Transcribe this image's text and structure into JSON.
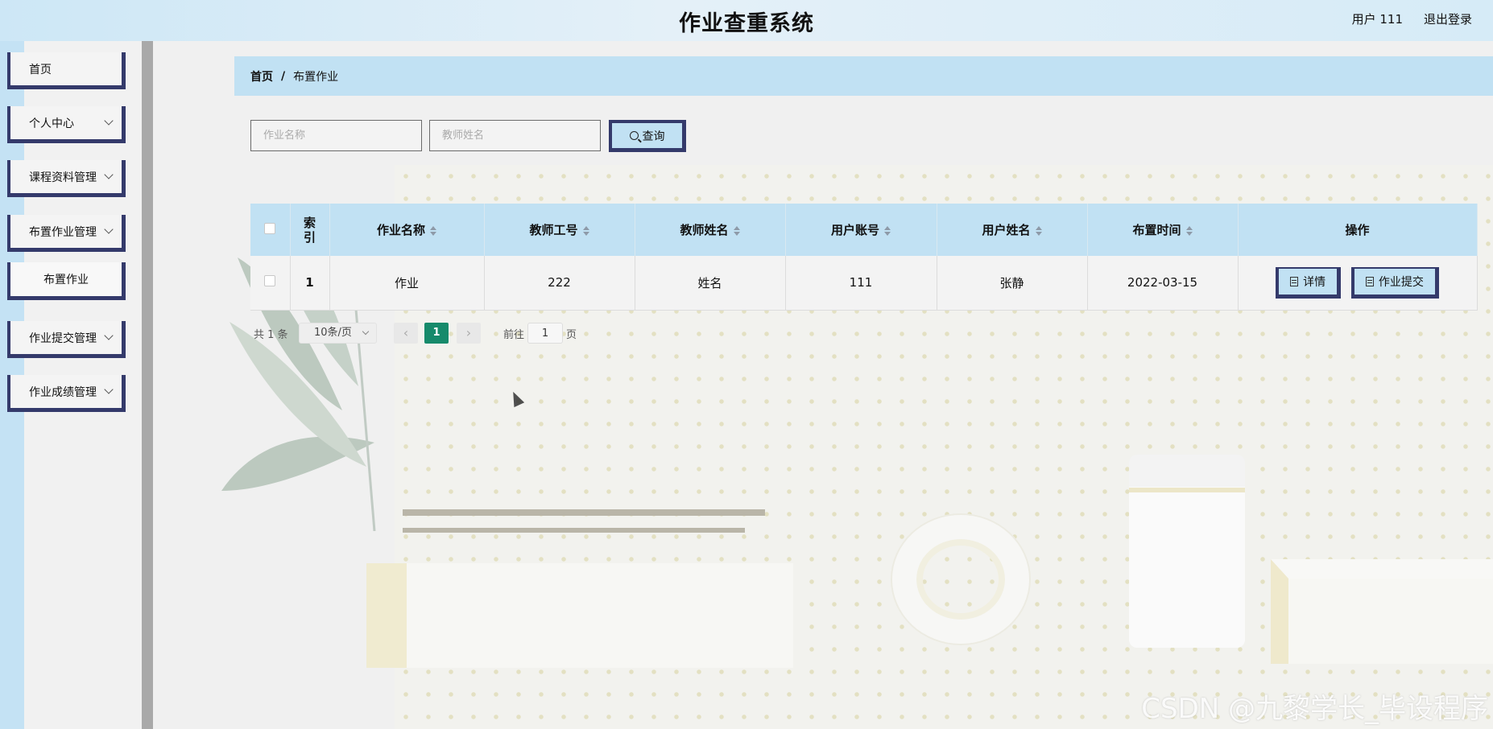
{
  "header": {
    "title": "作业查重系统",
    "user": "用户 111",
    "logout": "退出登录"
  },
  "sidebar": {
    "items": [
      {
        "label": "首页"
      },
      {
        "label": "个人中心"
      },
      {
        "label": "课程资料管理"
      },
      {
        "label": "布置作业管理"
      },
      {
        "label": "布置作业",
        "sub": true
      },
      {
        "label": "作业提交管理"
      },
      {
        "label": "作业成绩管理"
      }
    ]
  },
  "breadcrumb": {
    "home": "首页",
    "separator": "/",
    "current": "布置作业"
  },
  "search": {
    "homework_name_placeholder": "作业名称",
    "teacher_name_placeholder": "教师姓名",
    "button_label": "查询"
  },
  "table": {
    "headers": [
      "索引",
      "作业名称",
      "教师工号",
      "教师姓名",
      "用户账号",
      "用户姓名",
      "布置时间",
      "操作"
    ],
    "rows": [
      {
        "index": "1",
        "homework_name": "作业",
        "teacher_id": "222",
        "teacher_name": "姓名",
        "user_account": "111",
        "user_name": "张静",
        "time": "2022-03-15",
        "detail": "详情",
        "submit": "作业提交"
      }
    ]
  },
  "pagination": {
    "total": "共 1 条",
    "page_size": "10条/页",
    "current_page": "1",
    "goto_label": "前往",
    "goto_value": "1",
    "page_suffix": "页"
  },
  "watermark": "CSDN @九黎学长_毕设程序",
  "colors": {
    "accent": "#c1e1f3",
    "border": "#343a6b",
    "active_page": "#168a6b"
  }
}
